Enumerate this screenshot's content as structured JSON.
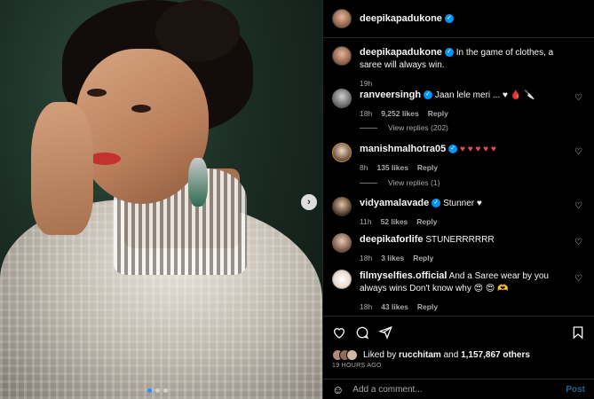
{
  "post": {
    "media": {
      "next_glyph": "›",
      "dots": [
        true,
        false,
        false
      ]
    },
    "header": {
      "username": "deepikapadukone"
    },
    "caption": {
      "username": "deepikapadukone",
      "text": "In the game of clothes, a saree will always win.",
      "time": "19h"
    },
    "comments": [
      {
        "username": "ranveersingh",
        "verified": true,
        "text": "Jaan lele meri ... ♥ 🩸 🔪",
        "time": "18h",
        "likes": "9,252 likes",
        "reply": "Reply"
      },
      {
        "username": "manishmalhotra05",
        "verified": true,
        "text": "♥ ♥ ♥ ♥ ♥",
        "time": "8h",
        "likes": "135 likes",
        "reply": "Reply"
      },
      {
        "username": "vidyamalavade",
        "verified": true,
        "text": "Stunner ♥",
        "time": "11h",
        "likes": "52 likes",
        "reply": "Reply"
      },
      {
        "username": "deepikaforlife",
        "verified": false,
        "text": "STUNERRRRRR",
        "time": "18h",
        "likes": "3 likes",
        "reply": "Reply"
      },
      {
        "username": "filmyselfies.official",
        "verified": false,
        "text": "And a Saree wear by you always wins Don't know why 😍 😍 🫶",
        "time": "18h",
        "likes": "43 likes",
        "reply": "Reply"
      }
    ],
    "view_replies": [
      "View replies (202)",
      "View replies (1)"
    ],
    "likes": {
      "prefix": "Liked by",
      "user": "rucchitam",
      "joiner": "and",
      "count": "1,157,867 others"
    },
    "time_ago": "19 HOURS AGO",
    "add_comment": {
      "placeholder": "Add a comment...",
      "post": "Post"
    }
  }
}
